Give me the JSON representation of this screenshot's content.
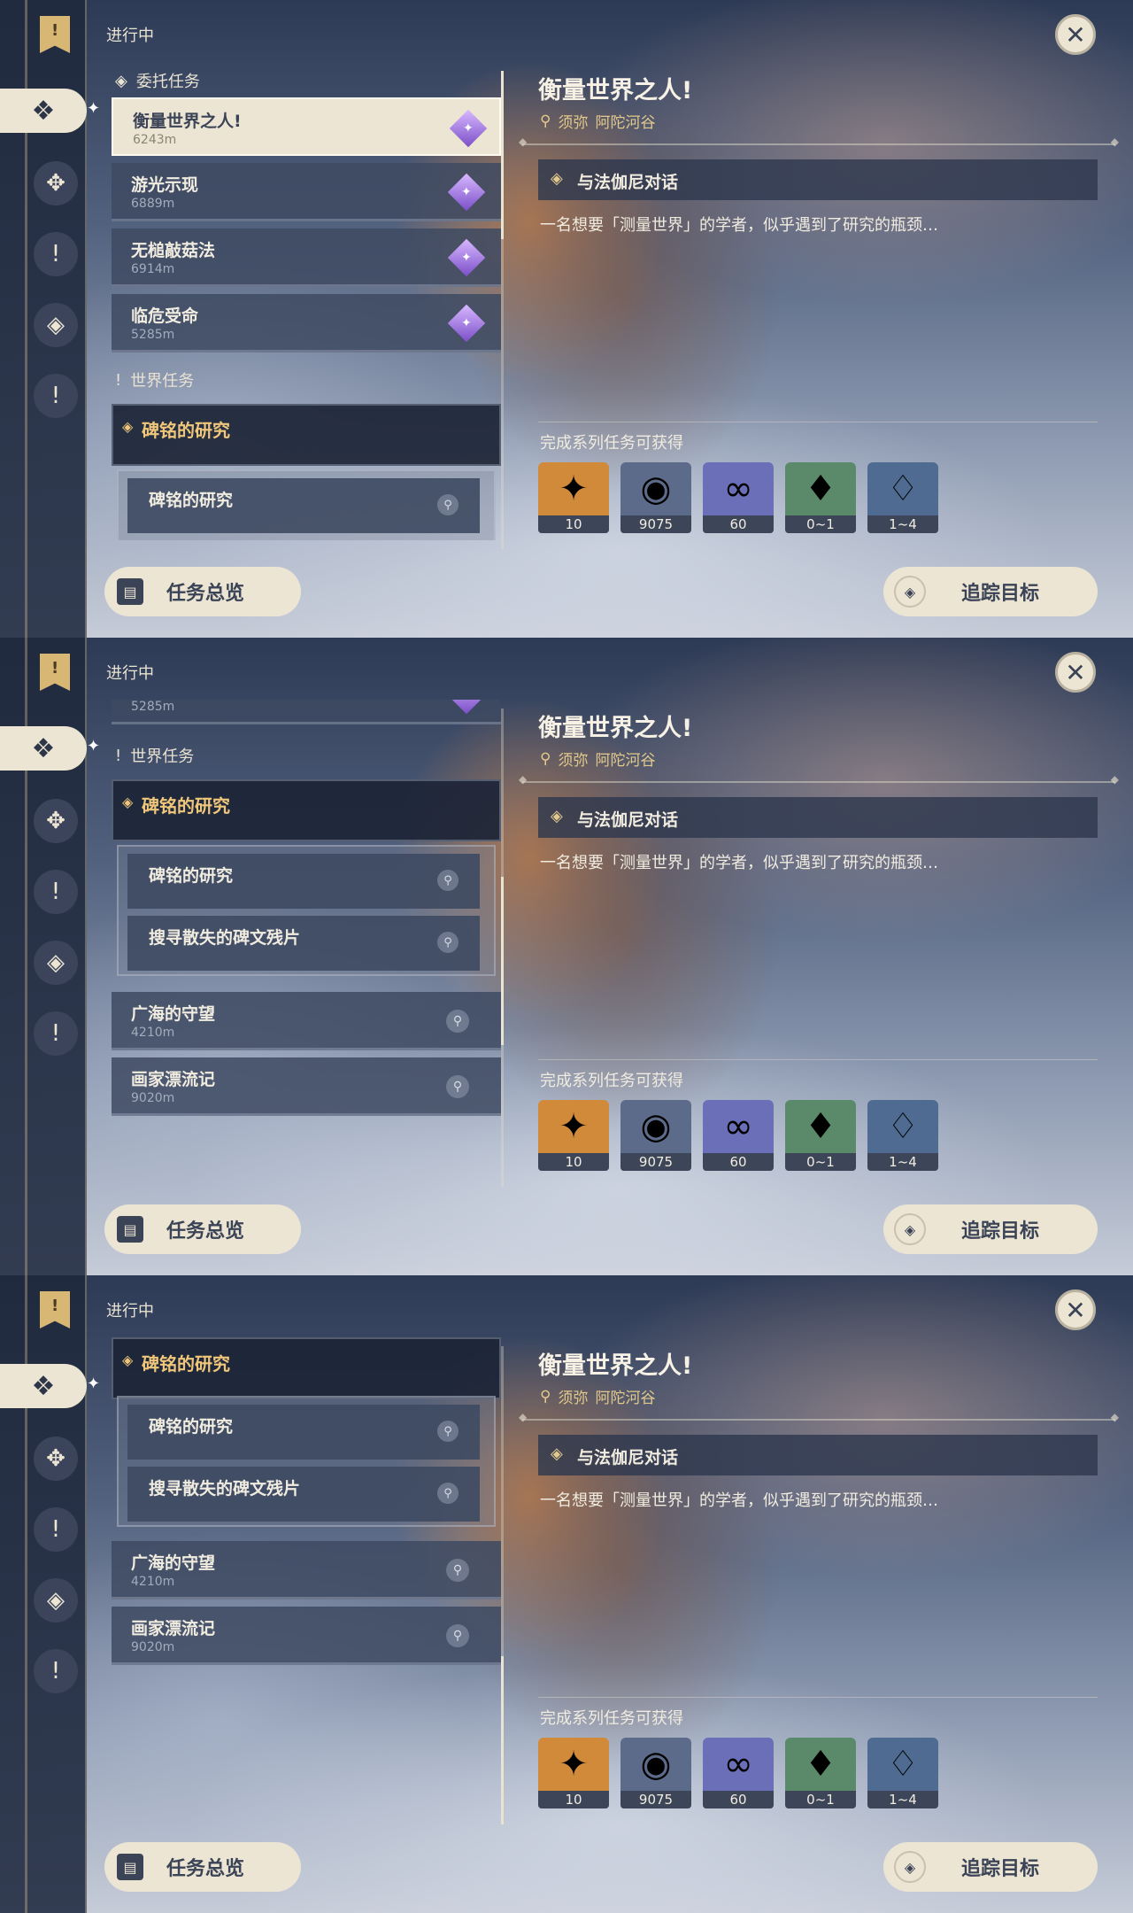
{
  "section_title": "进行中",
  "nav": {
    "bookmark_icon": "bookmark-icon",
    "items": [
      {
        "icon": "commission-icon",
        "glyph": "❖"
      },
      {
        "icon": "archon-quest-icon",
        "glyph": "✥"
      },
      {
        "icon": "story-quest-icon",
        "glyph": "!"
      },
      {
        "icon": "world-quest-diamond-icon",
        "glyph": "◈"
      },
      {
        "icon": "exclamation-icon",
        "glyph": "!"
      }
    ]
  },
  "list": {
    "commission_header": "委托任务",
    "world_header": "世界任务",
    "commissions": [
      {
        "name": "衡量世界之人!",
        "distance": "6243m",
        "selected": true
      },
      {
        "name": "游光示现",
        "distance": "6889m"
      },
      {
        "name": "无槌敲菇法",
        "distance": "6914m"
      },
      {
        "name": "临危受命",
        "distance": "5285m"
      }
    ],
    "chain": {
      "name": "碑铭的研究",
      "subs": [
        "碑铭的研究",
        "搜寻散失的碑文残片"
      ]
    },
    "world_quests": [
      {
        "name": "广海的守望",
        "distance": "4210m"
      },
      {
        "name": "画家漂流记",
        "distance": "9020m"
      }
    ]
  },
  "detail": {
    "title": "衡量世界之人!",
    "location": [
      "须弥",
      "阿陀河谷"
    ],
    "objective": "与法伽尼对话",
    "description": "一名想要「测量世界」的学者，似乎遇到了研究的瓶颈…",
    "rewards_title": "完成系列任务可获得",
    "rewards": [
      {
        "icon": "intertwined-fate-icon",
        "count": "10",
        "color": "#d08a3a"
      },
      {
        "icon": "mora-coin-icon",
        "count": "9075",
        "color": "#5d6b8a"
      },
      {
        "icon": "reputation-icon",
        "count": "60",
        "color": "#6a6fb8"
      },
      {
        "icon": "amethyst-crystal-icon",
        "count": "0~1",
        "color": "#5a8a6a"
      },
      {
        "icon": "pink-crystal-cluster-icon",
        "count": "1~4",
        "color": "#4f6b92"
      }
    ]
  },
  "buttons": {
    "overview": "任务总览",
    "track": "追踪目标"
  }
}
